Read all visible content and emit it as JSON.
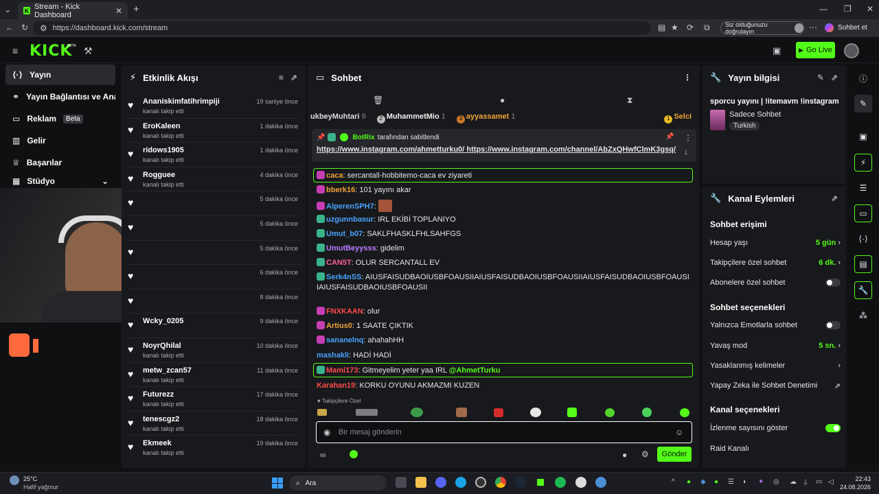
{
  "browser": {
    "tab_title": "Stream - Kick Dashboard",
    "url": "https://dashboard.kick.com/stream",
    "verify_label": "Siz olduğunuzu doğrulayın",
    "chat_label": "Sohbet et"
  },
  "app": {
    "logo": "KICK",
    "beta": "BETA",
    "go_live": "Go Live"
  },
  "sidebar": {
    "items": [
      {
        "label": "Yayın"
      },
      {
        "label": "Yayın Bağlantısı ve Anahtar"
      },
      {
        "label": "Reklam",
        "badge": "Beta"
      },
      {
        "label": "Gelir"
      },
      {
        "label": "Başarılar"
      },
      {
        "label": "Stüdyo"
      }
    ]
  },
  "activity": {
    "title": "Etkinlik Akışı",
    "items": [
      {
        "name": "Ananiskimfatihrimpiji",
        "sub": "kanalı takip etti",
        "time": "19 saniye önce"
      },
      {
        "name": "EroKaleen",
        "sub": "kanalı takip etti",
        "time": "1 dakika önce"
      },
      {
        "name": "ridows1905",
        "sub": "kanalı takip etti",
        "time": "1 dakika önce"
      },
      {
        "name": "Rogguee",
        "sub": "kanalı takip etti",
        "time": "4 dakika önce"
      },
      {
        "name": "",
        "sub": "",
        "time": "5 dakika önce"
      },
      {
        "name": "",
        "sub": "",
        "time": "5 dakika önce"
      },
      {
        "name": "",
        "sub": "",
        "time": "5 dakika önce"
      },
      {
        "name": "",
        "sub": "",
        "time": "6 dakika önce"
      },
      {
        "name": "",
        "sub": "",
        "time": "8 dakika önce"
      },
      {
        "name": "Wcky_0205",
        "sub": "",
        "time": "9 dakika önce"
      },
      {
        "name": "NoyrQhilal",
        "sub": "kanalı takip etti",
        "time": "10 dakika önce"
      },
      {
        "name": "metw_zcan57",
        "sub": "kanalı takip etti",
        "time": "11 dakika önce"
      },
      {
        "name": "Futurezz",
        "sub": "kanalı takip etti",
        "time": "17 dakika önce"
      },
      {
        "name": "tenescgz2",
        "sub": "kanalı takip etti",
        "time": "18 dakika önce"
      },
      {
        "name": "Ekmeek",
        "sub": "kanalı takip etti",
        "time": "19 dakika önce"
      }
    ]
  },
  "chat": {
    "title": "Sohbet",
    "leaders": [
      {
        "name": "ukbeyMuhtari",
        "count": "9",
        "rank": ""
      },
      {
        "name": "MuhammetMio",
        "count": "1",
        "rank": "2"
      },
      {
        "name": "ayyassamet",
        "count": "1",
        "rank": "3"
      },
      {
        "name": "Selci",
        "count": "",
        "rank": "1"
      }
    ],
    "pinned": {
      "by": "BotRix",
      "by_suffix": "tarafından sabitlendi",
      "link1": "https://www.instagram.com/ahmetturku0/",
      "link2": "https://www.instagram.com/channel/AbZxQHwfClmK3gsq/"
    },
    "messages": [
      {
        "user": "caca",
        "color": "#f0a33a",
        "text": "sercantall-hobbitemo-caca ev ziyareti",
        "highlight": true,
        "badge": "#c63eb3"
      },
      {
        "user": "bberk16",
        "color": "#f0a33a",
        "text": "101 yayını akar",
        "badge": "#c63eb3"
      },
      {
        "user": "AlperenSPH7",
        "color": "#4aa3ff",
        "text": "",
        "badge": "#c63eb3"
      },
      {
        "user": "uzgunnbasur",
        "color": "#4aa3ff",
        "text": "IRL EKİBİ TOPLANIYO",
        "badge": "#3ab38a"
      },
      {
        "user": "Umut_b07",
        "color": "#4aa3ff",
        "text": "SAKLFHASKLFHLSAHFGS",
        "badge": "#3ab38a"
      },
      {
        "user": "UmutBeyysss",
        "color": "#b77cff",
        "text": "gidelim",
        "badge": "#3ab38a"
      },
      {
        "user": "CAN5T",
        "color": "#ff5fa3",
        "text": "OLUR SERCANTALL EV",
        "badge": "#3ab38a"
      },
      {
        "user": "Serk4nSS",
        "color": "#4aa3ff",
        "text": "AIUSFAISUDBAOIUSBFOAUSIIAIUSFAISUDBAOIUSBFOAUSIIAIUSFAISUDBAOIUSBFOAUSIIAIUSFAISUDBAOIUSBFOAUSII",
        "badge": "#3ab38a"
      },
      {
        "user": "FNXKAAN",
        "color": "#ff4a4a",
        "text": "olur",
        "badge": "#c63eb3"
      },
      {
        "user": "Artius0",
        "color": "#f0a33a",
        "text": "1 SAATE ÇIKTIK",
        "badge": "#c63eb3"
      },
      {
        "user": "sananelnq",
        "color": "#4aa3ff",
        "text": "ahahahHH",
        "badge": "#c63eb3"
      },
      {
        "user": "mashakli",
        "color": "#4aa3ff",
        "text": "HADİ HADİ",
        "badge": ""
      },
      {
        "user": "Mami173",
        "color": "#ff4a4a",
        "text": "Gitmeyelim yeter yaa IRL",
        "mention": "@AhmetTurku",
        "highlight": true,
        "badge": "#3ab38a"
      },
      {
        "user": "Karahan19",
        "color": "#ff4a4a",
        "text": "KORKU OYUNU AKMAZMI KUZEN",
        "badge": ""
      }
    ],
    "followers_only": "Takipçilere Özel",
    "input_placeholder": "Bir mesaj gönderin",
    "send": "Gönder"
  },
  "stream_info": {
    "title": "Yayın bilgisi",
    "stream_title": "sporcu yayını | !itemavm !instagram",
    "category": "Sadece Sohbet",
    "tag": "Turkish"
  },
  "channel_actions": {
    "title": "Kanal Eylemleri",
    "chat_access": "Sohbet erişimi",
    "account_age": {
      "label": "Hesap yaşı",
      "value": "5 gün"
    },
    "followers_only": {
      "label": "Takipçilere özel sohbet",
      "value": "6 dk."
    },
    "subscribers_only": {
      "label": "Abonelere özel sohbet"
    },
    "chat_options": "Sohbet seçenekleri",
    "emotes_only": {
      "label": "Yalnızca Emotlarla sohbet"
    },
    "slow_mode": {
      "label": "Yavaş mod",
      "value": "5 sn."
    },
    "banned_words": {
      "label": "Yasaklanmış kelimeler"
    },
    "ai_moderation": {
      "label": "Yapay Zeka ile Sohbet Denetimi"
    },
    "channel_options": "Kanal seçenekleri",
    "show_viewers": {
      "label": "İzlenme sayısını göster"
    },
    "raid": {
      "label": "Raid Kanalı"
    }
  },
  "taskbar": {
    "weather_temp": "25°C",
    "weather_desc": "Hafif yağmur",
    "search": "Ara",
    "time": "22:43",
    "date": "24.08.2026"
  },
  "colors": {
    "accent": "#53fc18",
    "panel": "#18191c",
    "background": "#101113"
  }
}
